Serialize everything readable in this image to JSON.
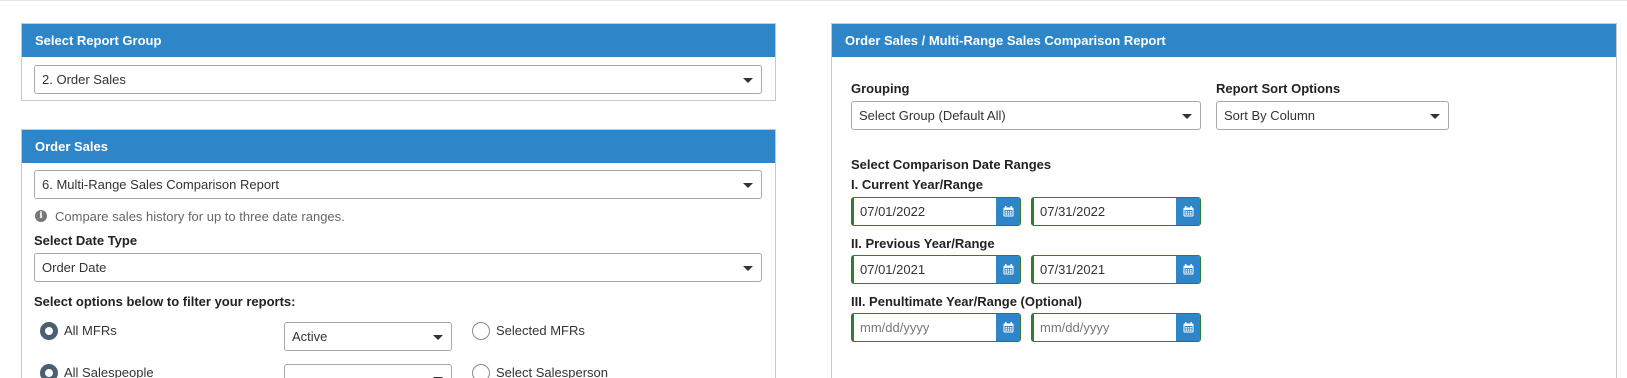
{
  "left_top": {
    "header": "Select Report Group",
    "report_group_value": "2. Order Sales"
  },
  "left_main": {
    "header": "Order Sales",
    "report_value": "6. Multi-Range Sales Comparison Report",
    "hint": "Compare sales history for up to three date ranges.",
    "date_type_label": "Select Date Type",
    "date_type_value": "Order Date",
    "filter_label": "Select options below to filter your reports:",
    "mfr_radio_label": "All MFRs",
    "mfr_status_value": "Active",
    "selected_mfr_label": "Selected MFRs",
    "salesperson_radio_label": "All Salespeople",
    "select_salesperson_label": "Select Salesperson"
  },
  "right": {
    "header": "Order Sales / Multi-Range Sales Comparison Report",
    "grouping_label": "Grouping",
    "grouping_value": "Select Group (Default All)",
    "sort_label": "Report Sort Options",
    "sort_value": "Sort By Column",
    "date_ranges_label": "Select Comparison Date Ranges",
    "range1_label": "I. Current Year/Range",
    "range1_start": "07/01/2022",
    "range1_end": "07/31/2022",
    "range2_label": "II. Previous Year/Range",
    "range2_start": "07/01/2021",
    "range2_end": "07/31/2021",
    "range3_label": "III. Penultimate Year/Range (Optional)",
    "date_placeholder": "mm/dd/yyyy"
  },
  "colors": {
    "header_blue": "#2e86c8",
    "valid_green": "#2e7d32"
  }
}
